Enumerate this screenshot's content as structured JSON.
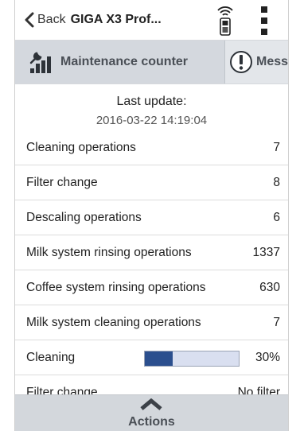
{
  "header": {
    "back_label": "Back",
    "device_title": "GIGA X3 Prof..."
  },
  "tabs": [
    {
      "label": "Maintenance counter",
      "icon": "maintenance-chart-icon",
      "active": true
    },
    {
      "label": "Mess",
      "icon": "exclamation-circle-icon",
      "active": false
    }
  ],
  "update": {
    "label": "Last update:",
    "timestamp": "2016-03-22 14:19:04"
  },
  "counters": [
    {
      "label": "Cleaning operations",
      "value": "7"
    },
    {
      "label": "Filter change",
      "value": "8"
    },
    {
      "label": "Descaling operations",
      "value": "6"
    },
    {
      "label": "Milk system rinsing operations",
      "value": "1337"
    },
    {
      "label": "Coffee system rinsing operations",
      "value": "630"
    },
    {
      "label": "Milk system cleaning operations",
      "value": "7"
    }
  ],
  "progress_rows": [
    {
      "label": "Cleaning",
      "value": "30%",
      "fraction": 0.3
    },
    {
      "label": "Filter change",
      "value": "No filter"
    }
  ],
  "actions": {
    "label": "Actions"
  },
  "colors": {
    "progress_fill": "#2b4f8e",
    "progress_track": "#d9dff0",
    "tab_bar": "#e3e6ea",
    "actions_bar": "#d3d7dc"
  }
}
